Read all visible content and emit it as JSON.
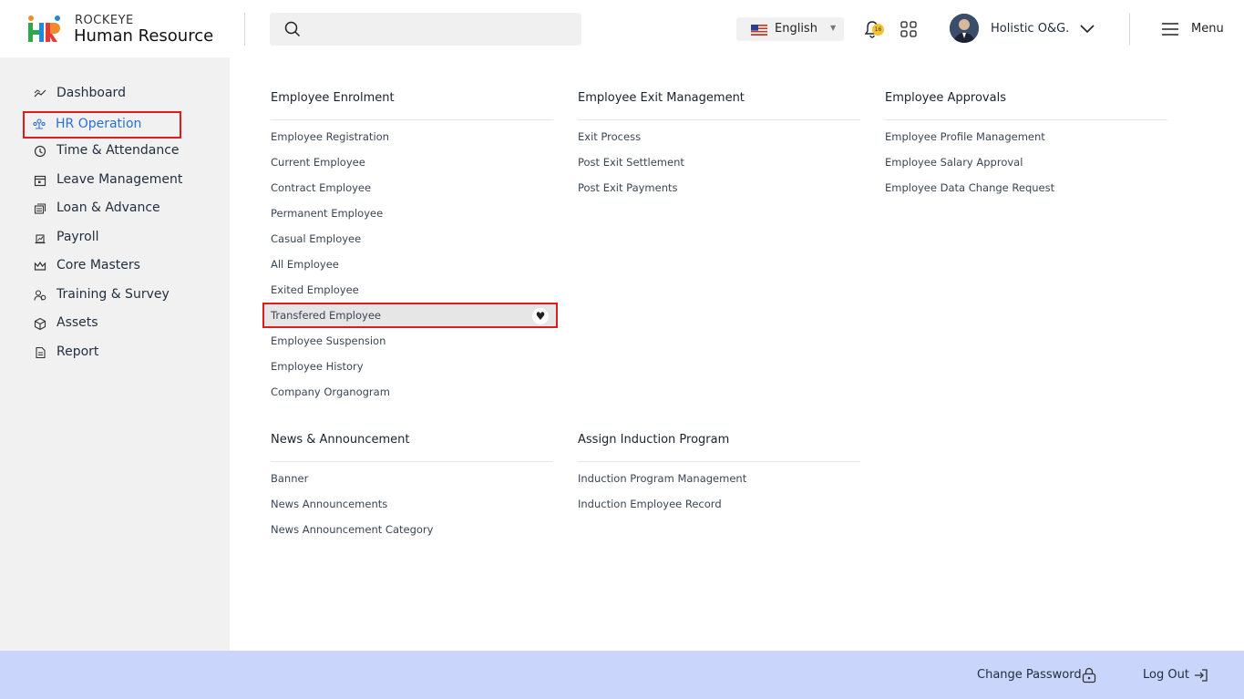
{
  "app": {
    "brand_top": "ROCKEYE",
    "brand_main": "Human Resource"
  },
  "header": {
    "language": "English",
    "notification_count": "16",
    "user_name": "Holistic O&G.",
    "menu_label": "Menu"
  },
  "sidebar": {
    "items": [
      {
        "label": "Dashboard",
        "icon": "chart-line-icon"
      },
      {
        "label": "HR Operation",
        "icon": "people-network-icon"
      },
      {
        "label": "Time & Attendance",
        "icon": "clock-icon"
      },
      {
        "label": "Leave Management",
        "icon": "calendar-icon"
      },
      {
        "label": "Loan & Advance",
        "icon": "money-stack-icon"
      },
      {
        "label": "Payroll",
        "icon": "payroll-icon"
      },
      {
        "label": "Core Masters",
        "icon": "crown-icon"
      },
      {
        "label": "Training & Survey",
        "icon": "training-icon"
      },
      {
        "label": "Assets",
        "icon": "box-icon"
      },
      {
        "label": "Report",
        "icon": "document-icon"
      }
    ]
  },
  "sections": {
    "enrolment": {
      "title": "Employee Enrolment",
      "items": [
        "Employee Registration",
        "Current Employee",
        "Contract Employee",
        "Permanent Employee",
        "Casual Employee",
        "All Employee",
        "Exited Employee",
        "Transfered Employee",
        "Employee Suspension",
        "Employee History",
        "Company Organogram"
      ]
    },
    "exit": {
      "title": "Employee Exit Management",
      "items": [
        "Exit Process",
        "Post Exit Settlement",
        "Post Exit Payments"
      ]
    },
    "approvals": {
      "title": "Employee Approvals",
      "items": [
        "Employee Profile Management",
        "Employee Salary Approval",
        "Employee Data Change Request"
      ]
    },
    "news": {
      "title": "News & Announcement",
      "items": [
        "Banner",
        "News Announcements",
        "News Announcement Category"
      ]
    },
    "induction": {
      "title": "Assign Induction Program",
      "items": [
        "Induction Program Management",
        "Induction Employee Record"
      ]
    }
  },
  "footer": {
    "change_password": "Change Password",
    "logout": "Log Out"
  },
  "colors": {
    "accent": "#2a6fd6",
    "highlight_border": "#e01b1b",
    "footer_bg": "#c9d5fb",
    "sidebar_bg": "#f1f1f1"
  }
}
